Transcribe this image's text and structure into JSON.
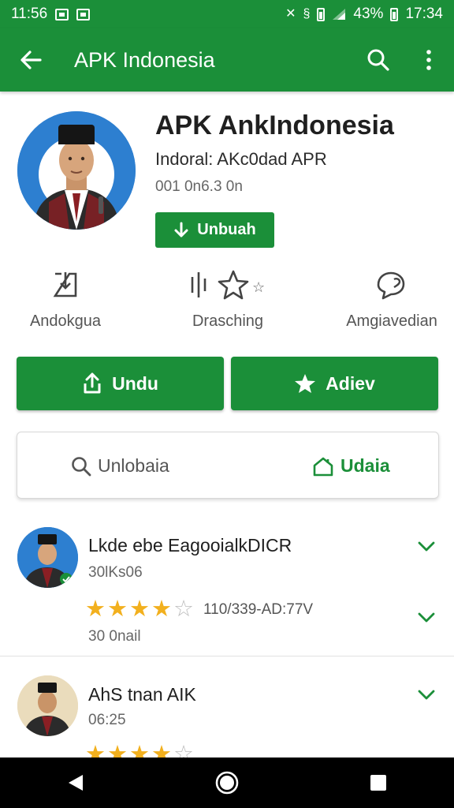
{
  "status_bar": {
    "left_text": "11:56",
    "battery_text": "43%",
    "time": "17:34"
  },
  "app_bar": {
    "title": "APK Indonesia",
    "icons": [
      "back-arrow-icon",
      "search-icon",
      "more-vert-icon"
    ]
  },
  "app": {
    "title": "APK AnkIndonesia",
    "developer": "Indoral: AKc0dad APR",
    "meta": "001 0n6.3 0n",
    "install_label": "Unbuah"
  },
  "stats": [
    {
      "label": "Andokgua",
      "icon": "download-doc-icon"
    },
    {
      "label": "Drasching",
      "icon": "rating-icon"
    },
    {
      "label": "Amgiavedian",
      "icon": "chat-icon"
    }
  ],
  "actions": {
    "primary": {
      "label": "Undu",
      "icon": "share-icon"
    },
    "secondary": {
      "label": "Adiev",
      "icon": "star-icon"
    }
  },
  "search_card": {
    "search_label": "Unlobaia",
    "home_label": "Udaia"
  },
  "reviews": [
    {
      "name": "Lkde ebe EagooialkDICR",
      "sub": "30lKs06",
      "stars": 4,
      "date": "110/339-AD:77V",
      "extra": "30 0nail"
    },
    {
      "name": "AhS tnan AIK",
      "sub": "06:25",
      "stars": 4,
      "date": "",
      "extra": ""
    }
  ],
  "colors": {
    "brand_green": "#1b8f39",
    "star_gold": "#f2b01e",
    "navbar": "#000000"
  }
}
